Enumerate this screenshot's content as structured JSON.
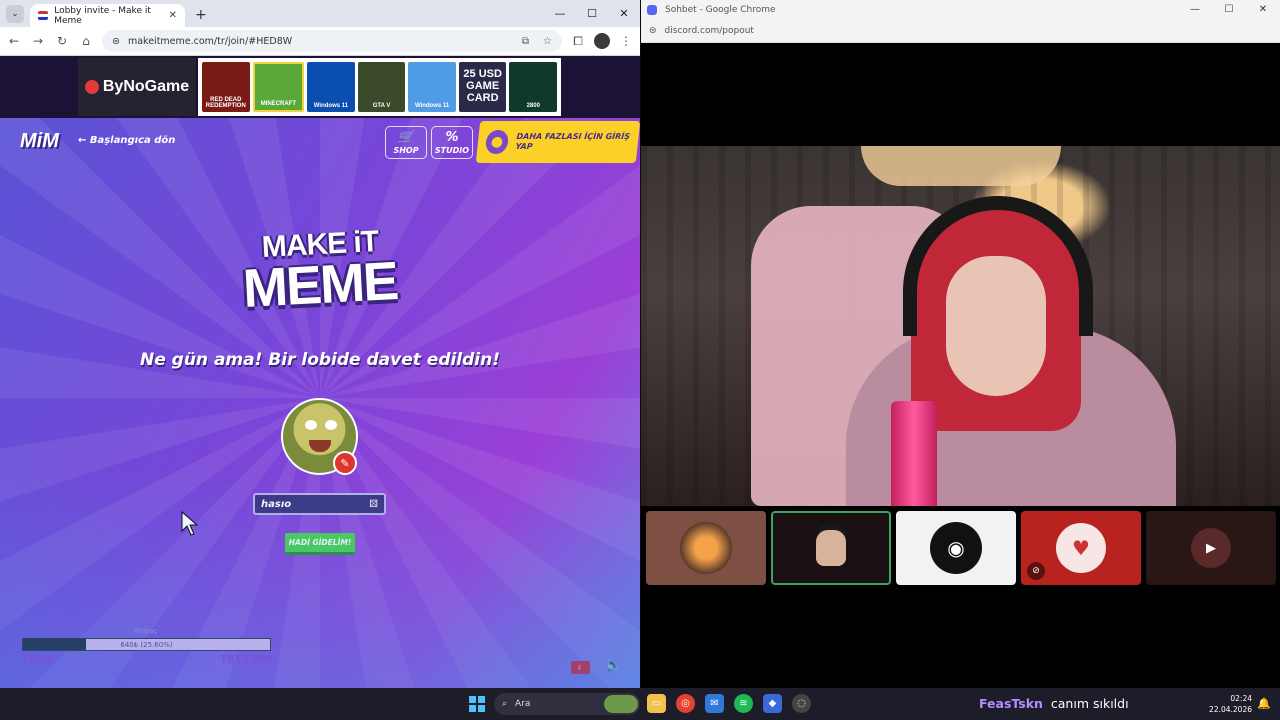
{
  "left_window": {
    "tab_title": "Lobby invite - Make it Meme",
    "new_tab": "+",
    "url": "makeitmeme.com/tr/join/#HED8W"
  },
  "ad": {
    "brand": "ByNoGame",
    "cards": [
      "RED DEAD REDEMPTION",
      "MINECRAFT",
      "Windows 11",
      "GTA V",
      "Windows 11",
      "25 USD GAME CARD",
      "2800"
    ]
  },
  "game": {
    "logo_small": "MiM",
    "back_link": "← Başlangıca dön",
    "shop_label": "SHOP",
    "studio_label": "STUDIO",
    "login_label": "DAHA FAZLASI İÇİN GİRİŞ YAP",
    "logo_line1": "MAKE iT",
    "logo_line2": "MEME",
    "invite_text": "Ne gün ama! Bir lobide davet edildin!",
    "name_value": "hasıo",
    "go_button": "HADİ GİDELİM!",
    "progress": {
      "label": "İhtiyaç",
      "fraction": 0.256,
      "text": "640₺ (25.60%)",
      "min": "TRY0",
      "max": "TRY2500"
    }
  },
  "right_window": {
    "title": "Sohbet - Google Chrome",
    "url": "discord.com/popout"
  },
  "taskbar": {
    "search_placeholder": "Ara",
    "chat_user": "FeasTskn",
    "chat_message": "canım sıkıldı",
    "time": "02:24",
    "date": "22.04.2026"
  },
  "colors": {
    "accent_yellow": "#fbd127",
    "go_green": "#4bd34b",
    "discord_blurple": "#5865f2",
    "speaking_green": "#3ba55d"
  }
}
